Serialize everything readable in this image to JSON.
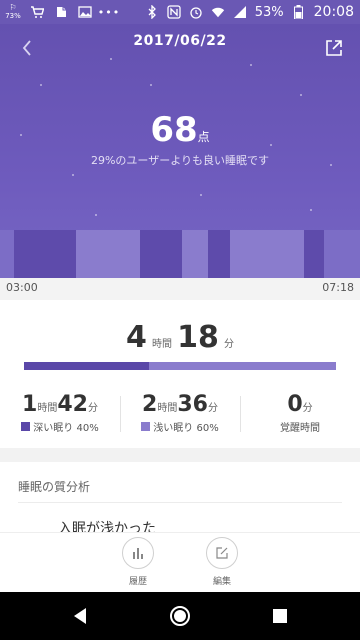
{
  "status_bar": {
    "battery": "53%",
    "time": "20:08",
    "left_icons": [
      "step-badge-icon",
      "cart-icon",
      "evernote-icon",
      "image-icon",
      "more-dots-icon"
    ],
    "step_badge": "73%",
    "right_icons": [
      "bluetooth-icon",
      "nfc-icon",
      "alarm-icon",
      "wifi-icon",
      "signal-icon",
      "battery-icon"
    ]
  },
  "header": {
    "date": "2017/06/22",
    "back_icon": "chevron-left-icon",
    "share_icon": "share-icon"
  },
  "score": {
    "value": "68",
    "unit": "点",
    "comparison": "29%のユーザーよりも良い睡眠です"
  },
  "sleep_chart": {
    "start_time": "03:00",
    "end_time": "07:18",
    "colors": {
      "deep": "#5e4bab",
      "light": "#8a7ccd",
      "background": "#6e5bbd"
    }
  },
  "total": {
    "hours": "4",
    "hours_unit": "時間",
    "minutes": "18",
    "minutes_unit": "分",
    "deep_fraction": 0.4
  },
  "breakdown": {
    "deep": {
      "hours": "1",
      "hours_unit": "時間",
      "minutes": "42",
      "minutes_unit": "分",
      "label": "深い眠り 40%",
      "color": "#5a47a8"
    },
    "light": {
      "hours": "2",
      "hours_unit": "時間",
      "minutes": "36",
      "minutes_unit": "分",
      "label": "浅い眠り 60%",
      "color": "#8a7ccd"
    },
    "awake": {
      "minutes": "0",
      "minutes_unit": "分",
      "label": "覚醒時間"
    }
  },
  "analysis": {
    "title": "睡眠の質分析",
    "peek_text": "入眠が浅かった"
  },
  "tabs": [
    {
      "label": "履歴",
      "icon": "bar-chart-icon"
    },
    {
      "label": "編集",
      "icon": "edit-icon"
    }
  ],
  "nav": {
    "icons": [
      "back-triangle-icon",
      "home-circle-icon",
      "recents-square-icon"
    ]
  }
}
